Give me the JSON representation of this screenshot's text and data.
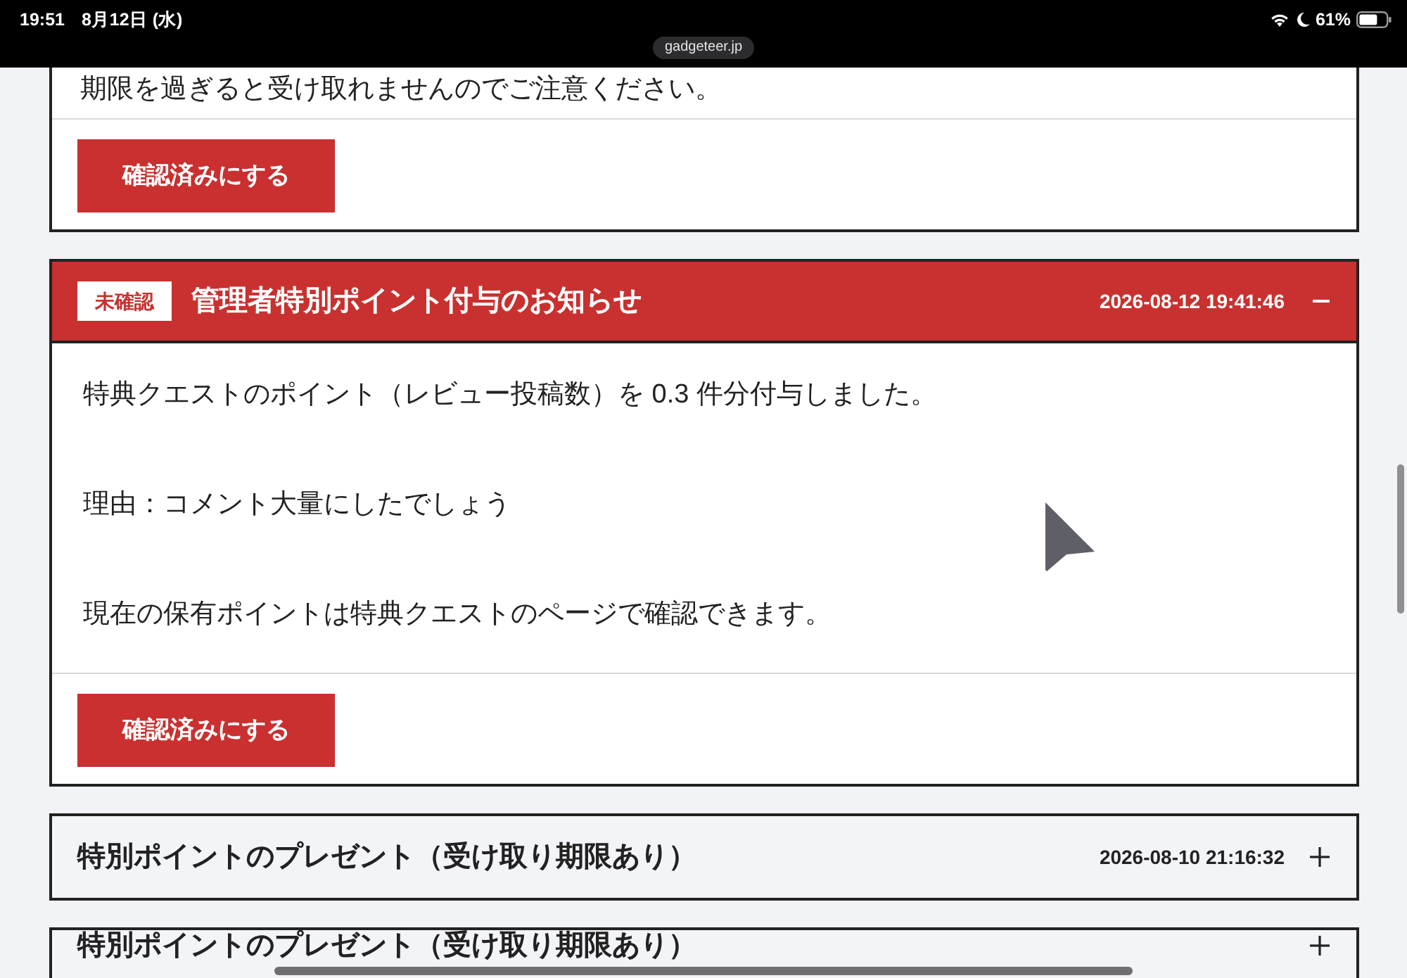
{
  "status_bar": {
    "time": "19:51",
    "date": "8月12日 (水)",
    "address": "gadgeteer.jp",
    "battery": "61%"
  },
  "notices": [
    {
      "paragraphs": [
        "期限を過ぎると受け取れませんのでご注意ください。"
      ],
      "button": "確認済みにする"
    },
    {
      "unread": true,
      "badge": "未確認",
      "title": "管理者特別ポイント付与のお知らせ",
      "timestamp": "2026-08-12 19:41:46",
      "expanded": true,
      "paragraphs": [
        "特典クエストのポイント（レビュー投稿数）を 0.3 件分付与しました。",
        "理由：コメント大量にしたでしょう",
        "現在の保有ポイントは特典クエストのページで確認できます。"
      ],
      "button": "確認済みにする"
    },
    {
      "unread": false,
      "title": "特別ポイントのプレゼント（受け取り期限あり）",
      "timestamp": "2026-08-10 21:16:32",
      "expanded": false
    },
    {
      "unread": false,
      "title": "特別ポイントのプレゼント（受け取り期限あり）",
      "expanded": false
    }
  ]
}
